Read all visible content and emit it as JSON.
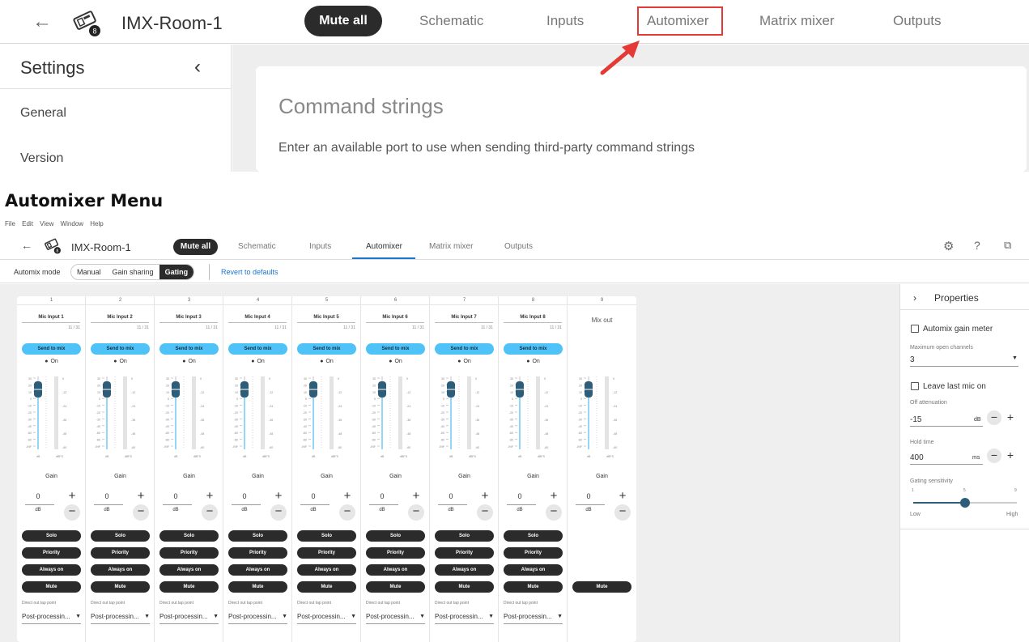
{
  "top": {
    "device_title": "IMX-Room-1",
    "device_badge": "8",
    "mute_all": "Mute all",
    "tabs": [
      "Schematic",
      "Inputs",
      "Automixer",
      "Matrix mixer",
      "Outputs"
    ],
    "highlighted_tab": "Automixer",
    "settings_title": "Settings",
    "settings_items": [
      "General",
      "Version"
    ],
    "card_title": "Command strings",
    "card_text": "Enter an available port to use when sending third-party command strings",
    "highlight_color": "#e53935"
  },
  "caption": "Automixer Menu",
  "app": {
    "menubar": [
      "File",
      "Edit",
      "View",
      "Window",
      "Help"
    ],
    "device_title": "IMX-Room-1",
    "device_badge": "8",
    "mute_all": "Mute all",
    "tabs": [
      "Schematic",
      "Inputs",
      "Automixer",
      "Matrix mixer",
      "Outputs"
    ],
    "active_tab": "Automixer",
    "header_icons": [
      "gear-icon",
      "help-icon",
      "open-external-icon"
    ],
    "toolbar": {
      "mode_label": "Automix mode",
      "modes": [
        "Manual",
        "Gain sharing",
        "Gating"
      ],
      "active_mode": "Gating",
      "revert": "Revert to defaults"
    },
    "channel": {
      "send_to_mix": "Send to mix",
      "on": "On",
      "gain_label": "Gain",
      "gain_value": "0",
      "gain_unit": "dB",
      "buttons": [
        "Solo",
        "Priority",
        "Always on",
        "Mute"
      ],
      "tap_label": "Direct out tap point",
      "tap_value": "Post-processin...",
      "count": "11 / 31",
      "scale_left": [
        "30",
        "20",
        "10",
        "0",
        "-10",
        "-20",
        "-30",
        "-40",
        "-60",
        "-80",
        "-INF"
      ],
      "scale_right": [
        "0",
        "-12",
        "-24",
        "-36",
        "-48",
        "-60"
      ],
      "scale_units": [
        "dB",
        "dBFS"
      ]
    },
    "channels": [
      {
        "num": "1",
        "name": "Mic Input 1"
      },
      {
        "num": "2",
        "name": "Mic Input 2"
      },
      {
        "num": "3",
        "name": "Mic Input 3"
      },
      {
        "num": "4",
        "name": "Mic Input 4"
      },
      {
        "num": "5",
        "name": "Mic Input 5"
      },
      {
        "num": "6",
        "name": "Mic Input 6"
      },
      {
        "num": "7",
        "name": "Mic Input 7"
      },
      {
        "num": "8",
        "name": "Mic Input 8"
      }
    ],
    "mixout": {
      "num": "9",
      "name": "Mix out",
      "mute": "Mute"
    },
    "properties": {
      "title": "Properties",
      "automix_gain_meter": "Automix gain meter",
      "max_open_label": "Maximum open channels",
      "max_open_value": "3",
      "leave_last_mic": "Leave last mic on",
      "off_att_label": "Off attenuation",
      "off_att_value": "-15",
      "off_att_unit": "dB",
      "hold_label": "Hold time",
      "hold_value": "400",
      "hold_unit": "ms",
      "gating_label": "Gating sensitivity",
      "gating_ticks": [
        "1",
        "5",
        "9"
      ],
      "gating_low": "Low",
      "gating_high": "High",
      "gating_value": 5
    },
    "accent": "#1976d2",
    "send_color": "#4fc3f7"
  }
}
